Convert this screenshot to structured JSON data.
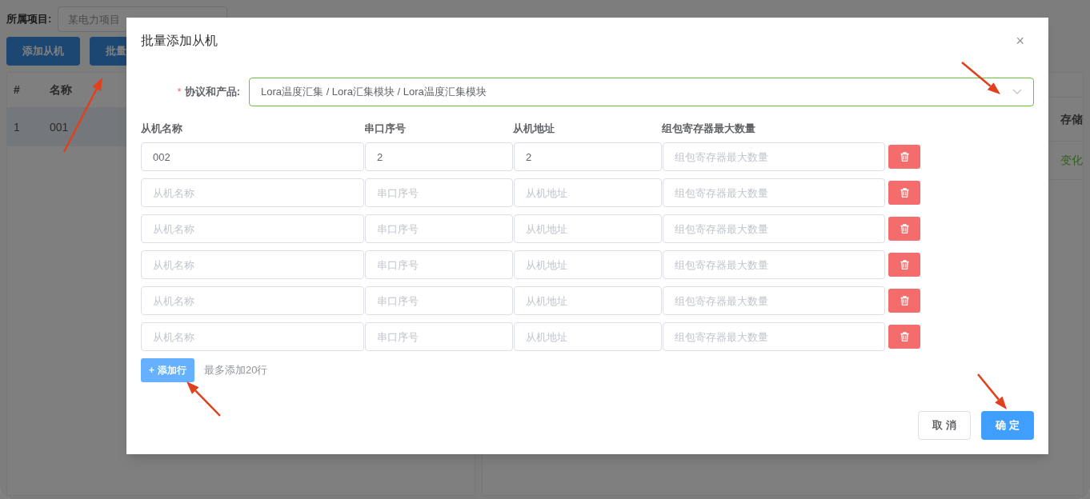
{
  "background": {
    "filters": [
      {
        "label": "所属项目:",
        "placeholder": "某电力项目"
      }
    ],
    "buttons": [
      "添加从机",
      "批量"
    ],
    "left_table": {
      "columns": [
        "#",
        "名称"
      ],
      "rows": [
        [
          "1",
          "001"
        ]
      ]
    },
    "right_table": {
      "columns": [
        "存储"
      ],
      "rows": [
        [
          "变化"
        ]
      ]
    }
  },
  "dialog": {
    "title": "批量添加从机",
    "close": "×",
    "protocol": {
      "required_mark": "*",
      "label": "协议和产品:",
      "value": "Lora温度汇集 / Lora汇集模块 / Lora温度汇集模块"
    },
    "columns": [
      "从机名称",
      "串口序号",
      "从机地址",
      "组包寄存器最大数量"
    ],
    "rows": [
      {
        "fields": [
          {
            "value": "002"
          },
          {
            "value": "2"
          },
          {
            "value": "2"
          },
          {
            "placeholder": "组包寄存器最大数量"
          }
        ]
      },
      {
        "fields": [
          {
            "placeholder": "从机名称"
          },
          {
            "placeholder": "串口序号"
          },
          {
            "placeholder": "从机地址"
          },
          {
            "placeholder": "组包寄存器最大数量"
          }
        ]
      },
      {
        "fields": [
          {
            "placeholder": "从机名称"
          },
          {
            "placeholder": "串口序号"
          },
          {
            "placeholder": "从机地址"
          },
          {
            "placeholder": "组包寄存器最大数量"
          }
        ]
      },
      {
        "fields": [
          {
            "placeholder": "从机名称"
          },
          {
            "placeholder": "串口序号"
          },
          {
            "placeholder": "从机地址"
          },
          {
            "placeholder": "组包寄存器最大数量"
          }
        ]
      },
      {
        "fields": [
          {
            "placeholder": "从机名称"
          },
          {
            "placeholder": "串口序号"
          },
          {
            "placeholder": "从机地址"
          },
          {
            "placeholder": "组包寄存器最大数量"
          }
        ]
      },
      {
        "fields": [
          {
            "placeholder": "从机名称"
          },
          {
            "placeholder": "串口序号"
          },
          {
            "placeholder": "从机地址"
          },
          {
            "placeholder": "组包寄存器最大数量"
          }
        ]
      }
    ],
    "add_row": {
      "icon": "+",
      "label": "添加行"
    },
    "hint": "最多添加20行",
    "cancel": "取 消",
    "confirm": "确 定"
  },
  "annotations": [
    {
      "kind": "arrow"
    },
    {
      "kind": "arrow"
    },
    {
      "kind": "arrow"
    },
    {
      "kind": "arrow"
    }
  ]
}
